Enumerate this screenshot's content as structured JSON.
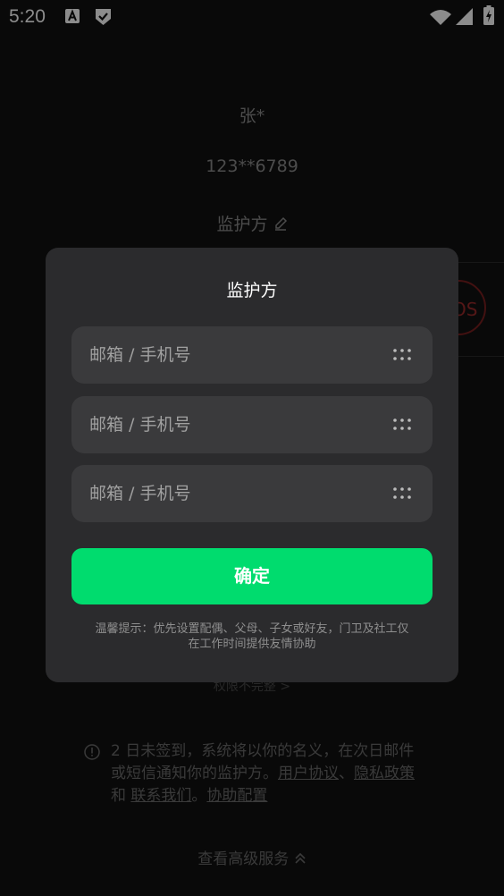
{
  "status_bar": {
    "time": "5:20"
  },
  "background": {
    "name": "张*",
    "phone": "123**6789",
    "guardian_label": "监护方",
    "sos_label": "OS",
    "permission_text": "权限不完整 >",
    "notice": {
      "text": "2 日未签到，系统将以你的名义，在次日邮件或短信通知你的监护方。",
      "link_user_agreement": "用户协议",
      "sep1": "、",
      "link_privacy": "隐私政策",
      "and": " 和 ",
      "link_contact": "联系我们",
      "sep2": "。",
      "link_assist": "协助配置"
    },
    "advanced_service": "查看高级服务"
  },
  "dialog": {
    "title": "监护方",
    "fields": [
      {
        "placeholder": "邮箱 / 手机号",
        "value": ""
      },
      {
        "placeholder": "邮箱 / 手机号",
        "value": ""
      },
      {
        "placeholder": "邮箱 / 手机号",
        "value": ""
      }
    ],
    "confirm_label": "确定",
    "hint": "温馨提示：优先设置配偶、父母、子女或好友，门卫及社工仅在工作时间提供友情协助"
  },
  "colors": {
    "accent": "#00dc6e",
    "dialog_bg": "#2b2b2d",
    "field_bg": "#3a3a3c",
    "background": "#111111"
  },
  "icons": [
    "translate-icon",
    "check-shield-icon",
    "wifi-icon",
    "signal-icon",
    "battery-icon",
    "pencil-icon",
    "info-icon",
    "chevron-up-icon",
    "contacts-dots-icon"
  ]
}
